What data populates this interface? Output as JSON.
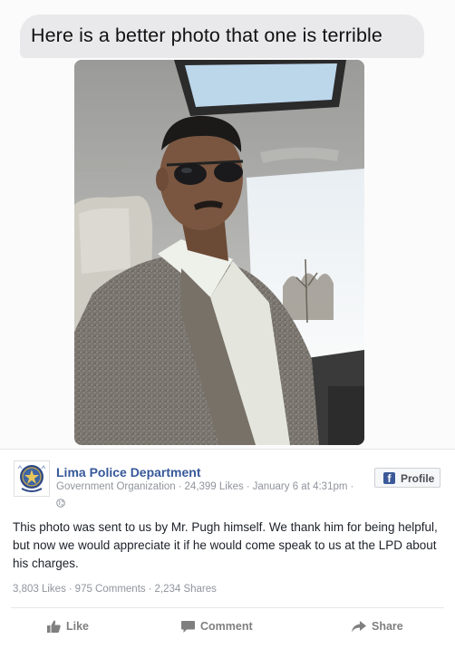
{
  "message": {
    "bubble_text": "Here is a better photo that one is terrible"
  },
  "post": {
    "page_name": "Lima Police Department",
    "category": "Government Organization",
    "likes": "24,399 Likes",
    "date": "January 6 at 4:31pm",
    "profile_button": "Profile",
    "text": "This photo was sent to us by Mr. Pugh himself. We thank him for being helpful, but now we would appreciate it if he would come speak to us at the LPD about his charges.",
    "stats": {
      "likes": "3,803 Likes",
      "comments": "975 Comments",
      "shares": "2,234 Shares"
    },
    "actions": {
      "like": "Like",
      "comment": "Comment",
      "share": "Share"
    }
  },
  "colors": {
    "facebook_blue": "#365899",
    "bubble_bg": "#e9e9eb",
    "meta_gray": "#90949c"
  },
  "icons": [
    "globe-icon",
    "facebook-f-icon",
    "thumbs-up-icon",
    "comment-icon",
    "share-arrow-icon",
    "police-badge-logo"
  ]
}
